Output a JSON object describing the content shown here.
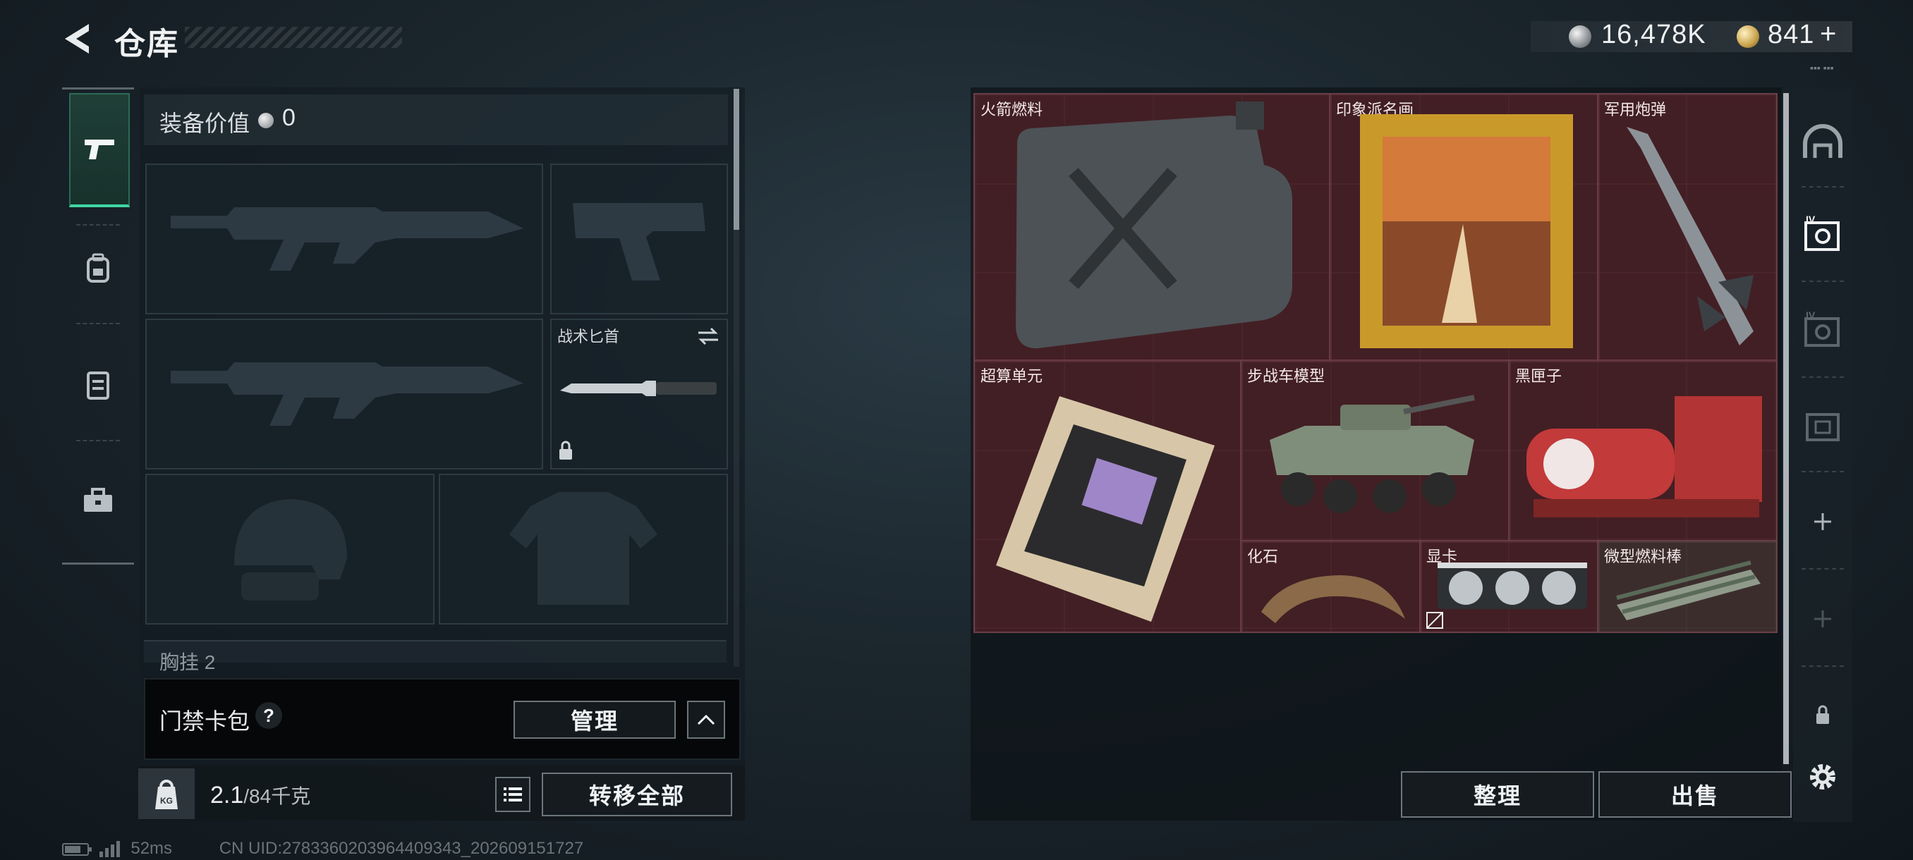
{
  "header": {
    "title": "仓库"
  },
  "currency": {
    "primary": "16,478K",
    "secondary": "841",
    "plus": "+",
    "extra": "▪▪▪ ▪▪▪"
  },
  "left_rail": {
    "tabs": [
      "gun-icon",
      "backpack-icon",
      "vest-icon",
      "toolbox-icon"
    ]
  },
  "equipment": {
    "value_label": "装备价值",
    "value": "0",
    "knife_label": "战术匕首",
    "chest_label": "胸挂",
    "chest_count": "2"
  },
  "card_pack": {
    "label": "门禁卡包",
    "help": "?",
    "manage": "管理"
  },
  "weight": {
    "current": "2.1",
    "max": "/84千克",
    "transfer_all": "转移全部",
    "icon_text": "KG"
  },
  "status": {
    "ping": "52ms",
    "uid": "CN UID:2783360203964409343_202609151727"
  },
  "stash": {
    "items": [
      {
        "label": "火箭燃料",
        "icon": "jerrycan-icon"
      },
      {
        "label": "印象派名画",
        "icon": "painting-icon"
      },
      {
        "label": "军用炮弹",
        "icon": "missile-icon"
      },
      {
        "label": "超算单元",
        "icon": "circuit-board-icon"
      },
      {
        "label": "步战车模型",
        "icon": "armored-vehicle-icon"
      },
      {
        "label": "黑匣子",
        "icon": "black-box-icon"
      },
      {
        "label": "化石",
        "icon": "fossil-claw-icon"
      },
      {
        "label": "显卡",
        "icon": "graphics-card-icon"
      },
      {
        "label": "微型燃料棒",
        "icon": "fuel-rods-icon"
      }
    ],
    "sort": "整理",
    "sell": "出售"
  },
  "right_rail": {
    "icons": [
      "dome-icon",
      "safe-box-iv-icon",
      "safe-box-iv-dim-icon",
      "safe-box-dim-icon",
      "add-icon",
      "add-dim-icon",
      "lock-icon",
      "settings-gear-icon"
    ]
  },
  "colors": {
    "accent": "#3fd6a1",
    "stash_bg": "#3e1d23"
  }
}
